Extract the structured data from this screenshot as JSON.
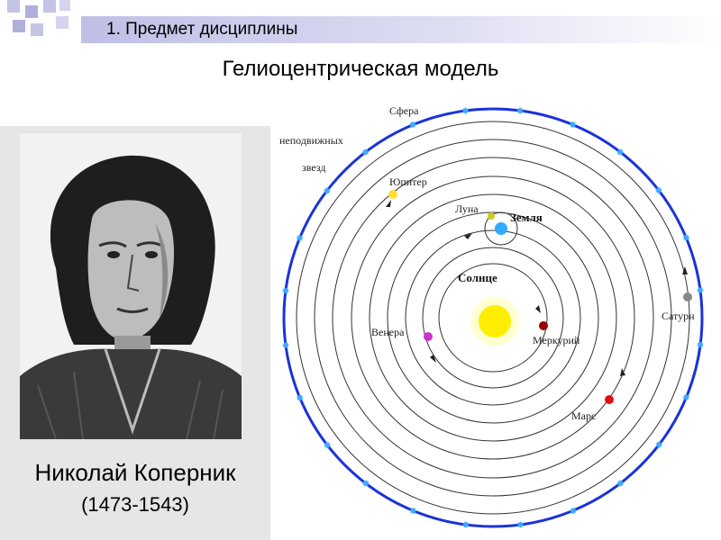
{
  "header": {
    "section_title": "1. Предмет дисциплины"
  },
  "main_title": "Гелиоцентрическая модель",
  "person": {
    "name": "Николай Коперник",
    "years": "(1473-1543)",
    "portrait_icon": "copernicus-portrait"
  },
  "diagram": {
    "sphere_label_1": "Сфера",
    "sphere_label_2": "неподвижных",
    "sphere_label_3": "звезд",
    "sun": "Солнце",
    "earth": "Земля",
    "moon": "Луна",
    "mercury": "Меркурий",
    "venus": "Венера",
    "mars": "Марс",
    "jupiter": "Юпитер",
    "saturn": "Сатурн"
  },
  "colors": {
    "title_bar": "#bfbfe6",
    "deco_squares": "#b0b0dc",
    "star_sphere": "#1a33d8",
    "sun": "#ffee00",
    "earth": "#33aaff",
    "moon": "#cccc22",
    "mercury": "#990000",
    "venus": "#cc33cc",
    "mars": "#dd1111",
    "jupiter": "#ffdd33",
    "saturn": "#888888"
  }
}
